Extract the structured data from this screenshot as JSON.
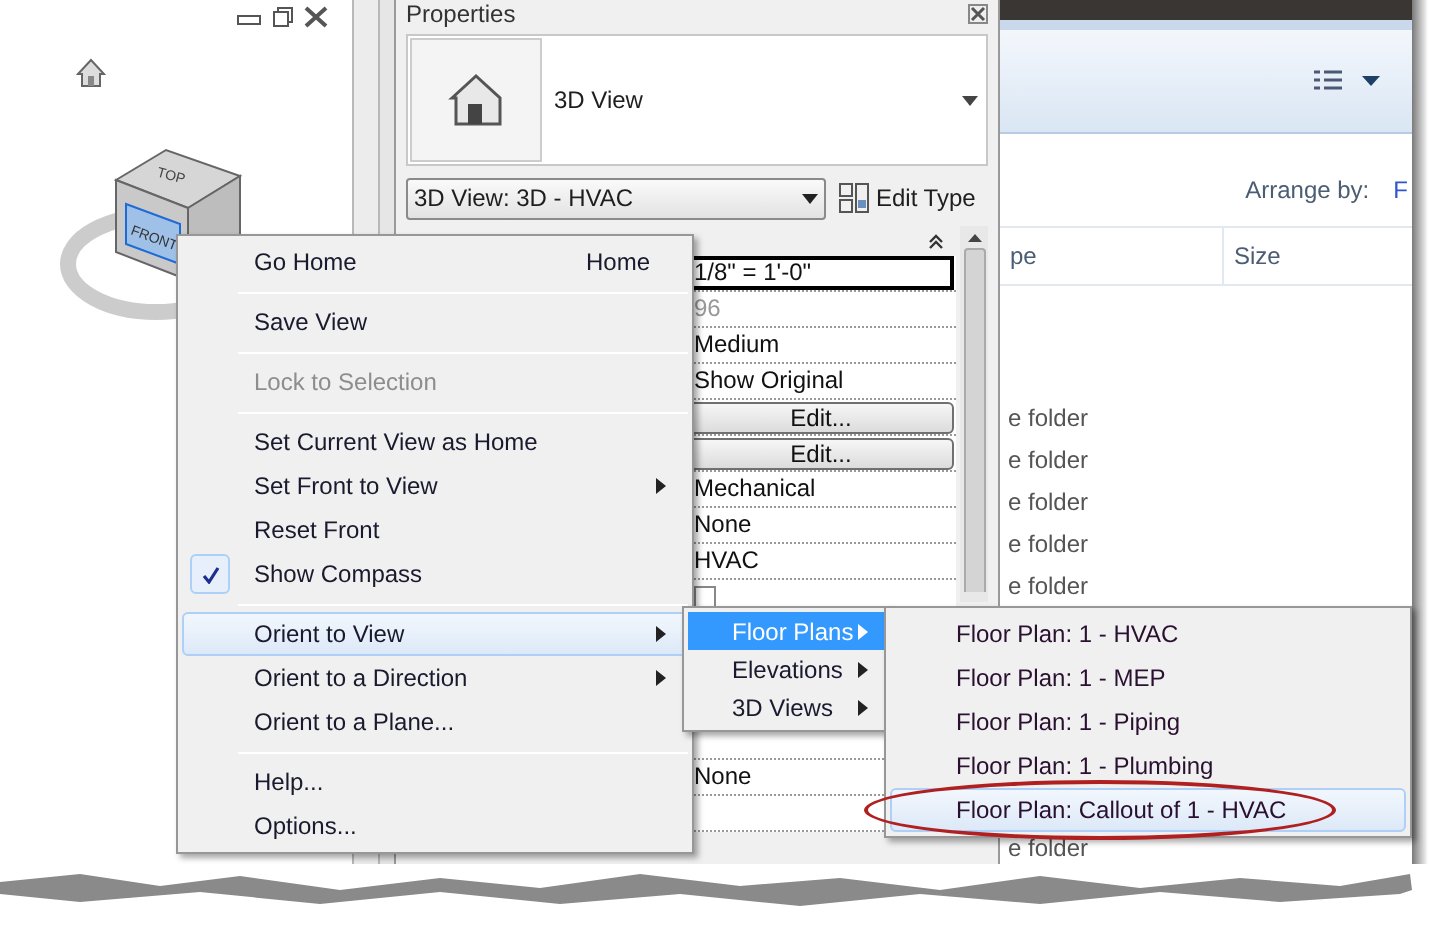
{
  "viewport": {
    "cube_labels": [
      "TOP",
      "FRONT"
    ]
  },
  "properties": {
    "title": "Properties",
    "type_name": "3D View",
    "type_selector": "3D View: 3D - HVAC",
    "edit_type": "Edit Type",
    "rows": [
      {
        "kind": "text",
        "value": "1/8\" = 1'-0\"",
        "selected": true
      },
      {
        "kind": "text",
        "value": "96",
        "disabled": true
      },
      {
        "kind": "text",
        "value": "Medium"
      },
      {
        "kind": "text",
        "value": "Show Original"
      },
      {
        "kind": "button",
        "value": "Edit..."
      },
      {
        "kind": "button",
        "value": "Edit..."
      },
      {
        "kind": "text",
        "value": "Mechanical"
      },
      {
        "kind": "text",
        "value": "None"
      },
      {
        "kind": "text",
        "value": "HVAC"
      },
      {
        "kind": "checkbox",
        "checked": false
      },
      {
        "kind": "blank"
      },
      {
        "kind": "blank"
      },
      {
        "kind": "blank"
      },
      {
        "kind": "blank"
      },
      {
        "kind": "text",
        "value": "None"
      },
      {
        "kind": "blank"
      }
    ]
  },
  "explorer": {
    "arrange_by_label": "Arrange by:",
    "arrange_by_value": "F",
    "columns": [
      "pe",
      "Size"
    ],
    "rows": [
      "e folder",
      "e folder",
      "e folder",
      "e folder",
      "e folder",
      "e folder"
    ]
  },
  "context_menu": {
    "items": [
      {
        "kind": "item",
        "label": "Go Home",
        "shortcut": "Home",
        "submenu": false,
        "disabled": false,
        "checked": false,
        "selected": false
      },
      {
        "kind": "separator"
      },
      {
        "kind": "item",
        "label": "Save View",
        "submenu": false,
        "disabled": false,
        "checked": false,
        "selected": false
      },
      {
        "kind": "separator"
      },
      {
        "kind": "item",
        "label": "Lock to Selection",
        "submenu": false,
        "disabled": true,
        "checked": false,
        "selected": false
      },
      {
        "kind": "separator"
      },
      {
        "kind": "item",
        "label": "Set Current View as Home",
        "submenu": false,
        "disabled": false,
        "checked": false,
        "selected": false
      },
      {
        "kind": "item",
        "label": "Set Front to View",
        "submenu": true,
        "disabled": false,
        "checked": false,
        "selected": false
      },
      {
        "kind": "item",
        "label": "Reset Front",
        "submenu": false,
        "disabled": false,
        "checked": false,
        "selected": false
      },
      {
        "kind": "item",
        "label": "Show Compass",
        "submenu": false,
        "disabled": false,
        "checked": true,
        "selected": false
      },
      {
        "kind": "separator"
      },
      {
        "kind": "item",
        "label": "Orient to View",
        "submenu": true,
        "disabled": false,
        "checked": false,
        "selected": true
      },
      {
        "kind": "item",
        "label": "Orient to a Direction",
        "submenu": true,
        "disabled": false,
        "checked": false,
        "selected": false
      },
      {
        "kind": "item",
        "label": "Orient to a Plane...",
        "submenu": false,
        "disabled": false,
        "checked": false,
        "selected": false
      },
      {
        "kind": "separator"
      },
      {
        "kind": "item",
        "label": "Help...",
        "submenu": false,
        "disabled": false,
        "checked": false,
        "selected": false
      },
      {
        "kind": "item",
        "label": "Options...",
        "submenu": false,
        "disabled": false,
        "checked": false,
        "selected": false
      }
    ]
  },
  "view_type_menu": {
    "items": [
      {
        "label": "Floor Plans",
        "selected": true
      },
      {
        "label": "Elevations",
        "selected": false
      },
      {
        "label": "3D Views",
        "selected": false
      }
    ]
  },
  "views_menu": {
    "items": [
      {
        "label": "Floor Plan: 1 - HVAC",
        "selected": false
      },
      {
        "label": "Floor Plan: 1 - MEP",
        "selected": false
      },
      {
        "label": "Floor Plan: 1 - Piping",
        "selected": false
      },
      {
        "label": "Floor Plan: 1 - Plumbing",
        "selected": false
      },
      {
        "label": "Floor Plan: Callout of 1 - HVAC",
        "selected": true,
        "circled": true
      }
    ]
  }
}
